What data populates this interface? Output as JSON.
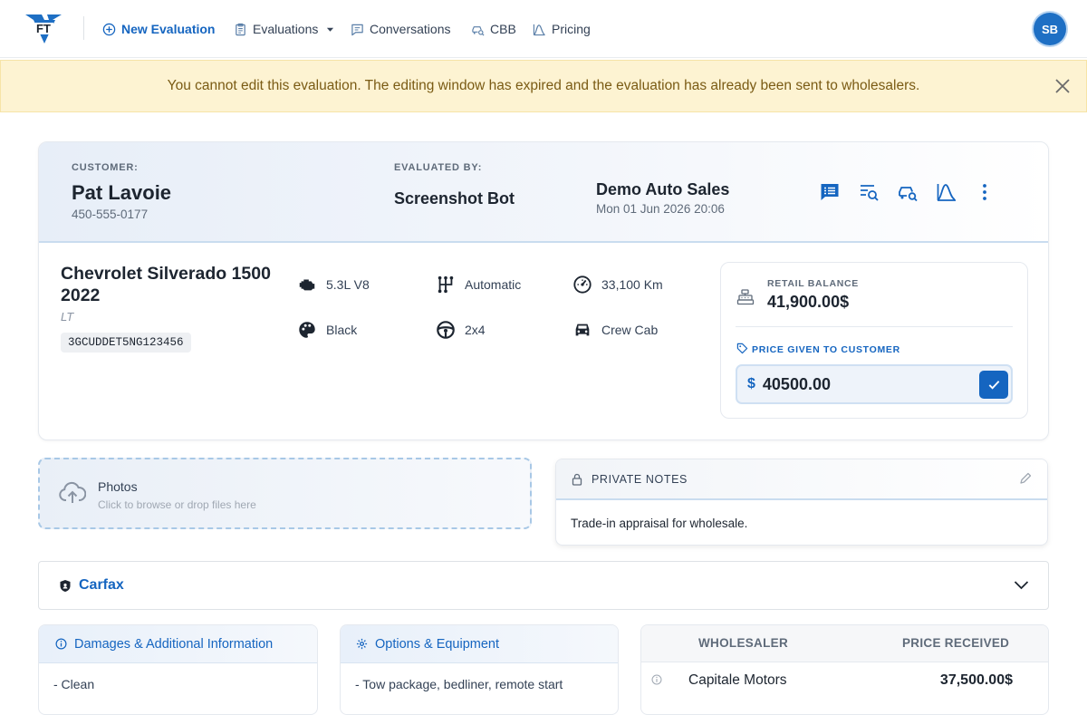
{
  "nav": {
    "logo_text": "FT",
    "new_evaluation": "New Evaluation",
    "evaluations": "Evaluations",
    "conversations": "Conversations",
    "cbb": "CBB",
    "pricing": "Pricing",
    "avatar_initials": "SB"
  },
  "alert": {
    "message": "You cannot edit this evaluation. The editing window has expired and the evaluation has already been sent to wholesalers."
  },
  "header": {
    "customer_label": "CUSTOMER:",
    "customer_name": "Pat Lavoie",
    "customer_phone": "450-555-0177",
    "evaluated_by_label": "EVALUATED BY:",
    "evaluator": "Screenshot Bot",
    "dealer": "Demo Auto Sales",
    "date": "Mon 01 Jun 2026 20:06"
  },
  "vehicle": {
    "title_line1": "Chevrolet Silverado 1500",
    "title_line2": "2022",
    "trim": "LT",
    "vin": "3GCUDDET5NG123456",
    "engine": "5.3L V8",
    "transmission": "Automatic",
    "mileage": "33,100 Km",
    "color": "Black",
    "drivetrain": "2x4",
    "body": "Crew Cab"
  },
  "pricing": {
    "retail_balance_label": "RETAIL BALANCE",
    "retail_balance": "41,900.00$",
    "price_given_label": "PRICE GIVEN TO CUSTOMER",
    "currency_symbol": "$",
    "price_given_value": "40500.00"
  },
  "photos": {
    "title": "Photos",
    "subtitle": "Click to browse or drop files here"
  },
  "notes": {
    "title": "PRIVATE NOTES",
    "body": "Trade-in appraisal for wholesale."
  },
  "carfax": {
    "title": "Carfax"
  },
  "damages": {
    "title": "Damages & Additional Information",
    "body": "- Clean"
  },
  "options": {
    "title": "Options & Equipment",
    "body": "- Tow package, bedliner, remote start"
  },
  "wholesalers": {
    "col_wholesaler": "WHOLESALER",
    "col_price": "PRICE RECEIVED",
    "rows": [
      {
        "name": "Capitale Motors",
        "price": "37,500.00$"
      }
    ]
  },
  "colors": {
    "primary": "#1565c0",
    "alert_bg": "#fdf3d2",
    "alert_text": "#7a5b14"
  }
}
